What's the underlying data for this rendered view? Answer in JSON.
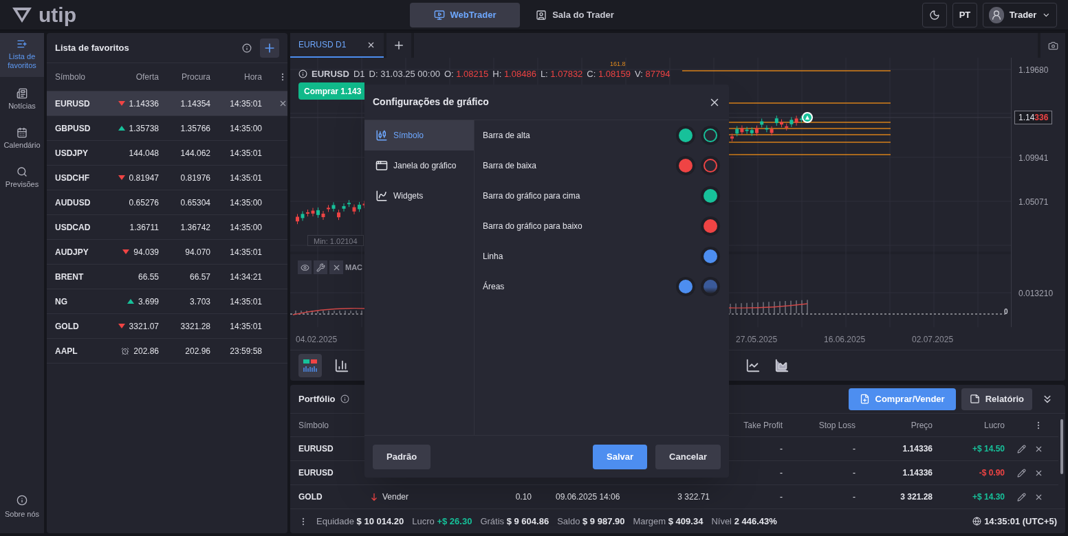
{
  "top_bar": {
    "logo": "utip",
    "tabs": [
      {
        "label": "WebTrader",
        "kind": "platform",
        "selected": true
      },
      {
        "label": "Sala do Trader",
        "kind": "room",
        "selected": false
      }
    ],
    "language": "PT",
    "user": "Trader"
  },
  "nav": {
    "items": [
      {
        "label": "Lista de favoritos",
        "kind": "favorites",
        "selected": true
      },
      {
        "label": "Notícias",
        "kind": "news",
        "selected": false
      },
      {
        "label": "Calendário",
        "kind": "calendar",
        "selected": false
      },
      {
        "label": "Previsões",
        "kind": "forecast",
        "selected": false
      }
    ],
    "footer": "Sobre nós"
  },
  "watchlist": {
    "title": "Lista de favoritos",
    "columns": {
      "symbol": "Símbolo",
      "bid": "Oferta",
      "ask": "Procura",
      "time": "Hora"
    },
    "rows": [
      {
        "symbol": "EURUSD",
        "bid": "1.14336",
        "ask": "1.14354",
        "time": "14:35:01",
        "kind": "down",
        "selected": true
      },
      {
        "symbol": "GBPUSD",
        "bid": "1.35738",
        "ask": "1.35766",
        "time": "14:35:00",
        "kind": "up",
        "selected": false
      },
      {
        "symbol": "USDJPY",
        "bid": "144.048",
        "ask": "144.062",
        "time": "14:35:01",
        "kind": "none",
        "selected": false
      },
      {
        "symbol": "USDCHF",
        "bid": "0.81947",
        "ask": "0.81976",
        "time": "14:35:01",
        "kind": "down",
        "selected": false
      },
      {
        "symbol": "AUDUSD",
        "bid": "0.65276",
        "ask": "0.65304",
        "time": "14:35:00",
        "kind": "none",
        "selected": false
      },
      {
        "symbol": "USDCAD",
        "bid": "1.36711",
        "ask": "1.36742",
        "time": "14:35:00",
        "kind": "none",
        "selected": false
      },
      {
        "symbol": "AUDJPY",
        "bid": "94.039",
        "ask": "94.070",
        "time": "14:35:01",
        "kind": "down",
        "selected": false
      },
      {
        "symbol": "BRENT",
        "bid": "66.55",
        "ask": "66.57",
        "time": "14:34:21",
        "kind": "none",
        "selected": false
      },
      {
        "symbol": "NG",
        "bid": "3.699",
        "ask": "3.703",
        "time": "14:35:01",
        "kind": "up",
        "selected": false
      },
      {
        "symbol": "GOLD",
        "bid": "3321.07",
        "ask": "3321.28",
        "time": "14:35:01",
        "kind": "down",
        "selected": false
      },
      {
        "symbol": "AAPL",
        "bid": "202.86",
        "ask": "202.96",
        "time": "23:59:58",
        "kind": "closed",
        "selected": false
      }
    ]
  },
  "chart": {
    "tab": {
      "label": "EURUSD D1",
      "selected": true
    },
    "legend": {
      "symbol": "EURUSD",
      "timeframe": "D1",
      "fields": [
        {
          "label": "D:",
          "value": "31.03.25 00:00",
          "kind": "plain"
        },
        {
          "label": "O:",
          "value": "1.08215",
          "kind": "down"
        },
        {
          "label": "H:",
          "value": "1.08486",
          "kind": "down"
        },
        {
          "label": "L:",
          "value": "1.07832",
          "kind": "down"
        },
        {
          "label": "C:",
          "value": "1.08159",
          "kind": "down"
        },
        {
          "label": "V:",
          "value": "87794",
          "kind": "down"
        }
      ]
    },
    "buy_button": "Comprar 1.143",
    "fib_label": "161.8",
    "min_label": "Min: 1.02104",
    "price_axis": [
      "1.19680",
      "1.09941",
      "1.05071"
    ],
    "current_price": {
      "head": "1.14",
      "tail": "336"
    },
    "indicator": "MAC",
    "indicator_axis": "0.013210",
    "zero_label": "0",
    "dates": [
      "04.02.2025",
      "27.05.2025",
      "16.06.2025",
      "02.07.2025"
    ],
    "toolbar_left": [
      {
        "kind": "candles",
        "selected": true
      },
      {
        "kind": "bars",
        "selected": false
      }
    ],
    "toolbar_right": [
      {
        "kind": "line",
        "selected": false
      },
      {
        "kind": "area",
        "selected": false
      }
    ]
  },
  "portfolio": {
    "title": "Portfólio",
    "trade_button": "Comprar/Vender",
    "report_button": "Relatório",
    "columns": {
      "symbol": "Símbolo",
      "take_profit": "Take Profit",
      "stop_loss": "Stop Loss",
      "price": "Preço",
      "profit": "Lucro"
    },
    "rows": [
      {
        "symbol": "EURUSD",
        "take_profit": "-",
        "stop_loss": "-",
        "price": "1.14336",
        "profit": "+$ 14.50",
        "positive": true
      },
      {
        "symbol": "EURUSD",
        "take_profit": "-",
        "stop_loss": "-",
        "price": "1.14336",
        "profit": "-$ 0.90",
        "positive": false
      },
      {
        "symbol": "GOLD",
        "side": "Vender",
        "volume": "0.10",
        "open_time": "09.06.2025 14:06",
        "open_price": "3 322.71",
        "take_profit": "-",
        "stop_loss": "-",
        "price": "3 321.28",
        "profit": "+$ 14.30",
        "positive": true
      }
    ],
    "status_bar": [
      {
        "label": "Equidade",
        "value": "$ 10 014.20",
        "kind": "plain"
      },
      {
        "label": "Lucro",
        "value": "+$ 26.30",
        "kind": "gain"
      },
      {
        "label": "Grátis",
        "value": "$ 9 604.86",
        "kind": "plain"
      },
      {
        "label": "Saldo",
        "value": "$ 9 987.90",
        "kind": "plain"
      },
      {
        "label": "Margem",
        "value": "$ 409.34",
        "kind": "plain"
      },
      {
        "label": "Nível",
        "value": "2 446.43%",
        "kind": "plain"
      }
    ],
    "clock": "14:35:01 (UTC+5)"
  },
  "dialog": {
    "title": "Configurações de gráfico",
    "tabs": [
      {
        "label": "Símbolo",
        "kind": "candles",
        "selected": true
      },
      {
        "label": "Janela do gráfico",
        "kind": "window",
        "selected": false
      },
      {
        "label": "Widgets",
        "kind": "widgets",
        "selected": false
      }
    ],
    "rows": [
      {
        "label": "Barra de alta",
        "swatches": [
          {
            "color": "#17c19a",
            "kind": "filled"
          },
          {
            "color": "#17c19a",
            "kind": "outline"
          }
        ]
      },
      {
        "label": "Barra de baixa",
        "swatches": [
          {
            "color": "#ef4444",
            "kind": "filled"
          },
          {
            "color": "#ef4444",
            "kind": "outline"
          }
        ]
      },
      {
        "label": "Barra do gráfico para cima",
        "swatches": [
          {
            "color": "#17c19a",
            "kind": "filled"
          }
        ]
      },
      {
        "label": "Barra do gráfico para baixo",
        "swatches": [
          {
            "color": "#ef4444",
            "kind": "filled"
          }
        ]
      },
      {
        "label": "Linha",
        "swatches": [
          {
            "color": "#4d8ef0",
            "kind": "filled"
          }
        ]
      },
      {
        "label": "Áreas",
        "swatches": [
          {
            "color": "#4d8ef0",
            "kind": "filled"
          },
          {
            "color": "#3a5a9a",
            "kind": "gradient"
          }
        ]
      }
    ],
    "reset_button": "Padrão",
    "save_button": "Salvar",
    "cancel_button": "Cancelar"
  }
}
